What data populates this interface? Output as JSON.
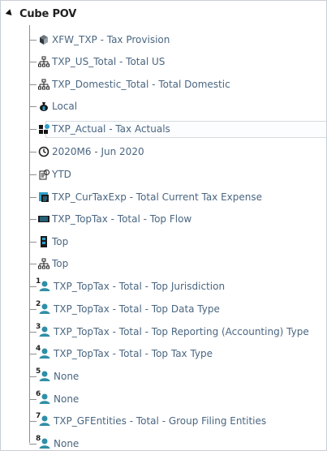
{
  "header": {
    "title": "Cube POV"
  },
  "tree": {
    "items": [
      {
        "label": "XFW_TXP - Tax Provision",
        "icon": "cube-icon"
      },
      {
        "label": "TXP_US_Total - Total US",
        "icon": "hierarchy-icon"
      },
      {
        "label": "TXP_Domestic_Total - Total Domestic",
        "icon": "hierarchy-icon"
      },
      {
        "label": "Local",
        "icon": "money-bag-icon"
      },
      {
        "label": "TXP_Actual - Tax Actuals",
        "icon": "scenario-icon"
      },
      {
        "label": "2020M6 - Jun 2020",
        "icon": "clock-icon"
      },
      {
        "label": "YTD",
        "icon": "view-icon"
      },
      {
        "label": "TXP_CurTaxExp - Total Current Tax Expense",
        "icon": "account-icon"
      },
      {
        "label": "TXP_TopTax - Total - Top Flow",
        "icon": "flow-icon"
      },
      {
        "label": "Top",
        "icon": "origin-icon"
      },
      {
        "label": "Top",
        "icon": "intercompany-icon"
      },
      {
        "label": "TXP_TopTax - Total - Top Jurisdiction",
        "icon": "person-icon",
        "index": "1"
      },
      {
        "label": "TXP_TopTax - Total - Top Data Type",
        "icon": "person-icon",
        "index": "2"
      },
      {
        "label": "TXP_TopTax - Total - Top Reporting (Accounting) Type",
        "icon": "person-icon",
        "index": "3"
      },
      {
        "label": "TXP_TopTax - Total - Top Tax Type",
        "icon": "person-icon",
        "index": "4"
      },
      {
        "label": "None",
        "icon": "person-icon",
        "index": "5"
      },
      {
        "label": "None",
        "icon": "person-icon",
        "index": "6"
      },
      {
        "label": "TXP_GFEntities - Total - Group Filing Entities",
        "icon": "person-icon",
        "index": "7"
      },
      {
        "label": "None",
        "icon": "person-icon",
        "index": "8"
      }
    ]
  },
  "colors": {
    "text": "#4a6680",
    "tree_line": "#8f8f8f",
    "person_icon": "#2f8fa7",
    "selected_border": "#d5dadf"
  }
}
